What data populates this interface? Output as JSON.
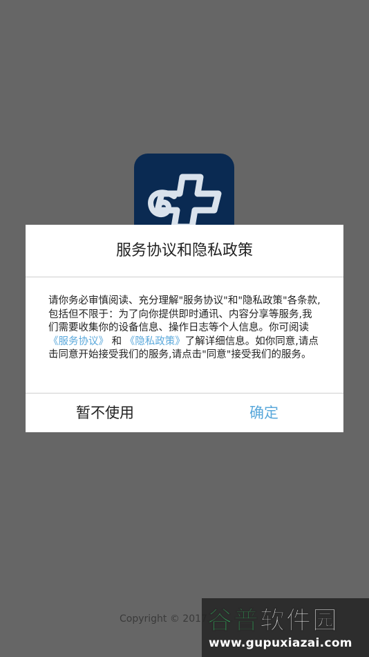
{
  "dialog": {
    "title": "服务协议和隐私政策",
    "body_part1": "请你务必审慎阅读、充分理解\"服务协议\"和\"隐私政策\"各条款,包括但不限于：为了向你提供即时通讯、内容分享等服务,我们需要收集你的设备信息、操作日志等个人信息。你可阅读",
    "link_service": "《服务协议》",
    "body_and": "和",
    "link_privacy": "《隐私政策》",
    "body_part2": "了解详细信息。如你同意,请点击同意开始接受我们的服务,请点击\"同意\"接受我们的服务。",
    "cancel_label": "暂不使用",
    "confirm_label": "确定"
  },
  "footer": {
    "copyright": "Copyright © 2017"
  },
  "watermark": {
    "brand_part1": "谷普",
    "brand_part2": "软件园",
    "url": "www.gupuxiazai.com"
  },
  "icons": {
    "app_logo": "app-logo-icon"
  },
  "colors": {
    "backdrop": "#666666",
    "link": "#5aa8db",
    "logo_bg": "#0a2a52"
  }
}
